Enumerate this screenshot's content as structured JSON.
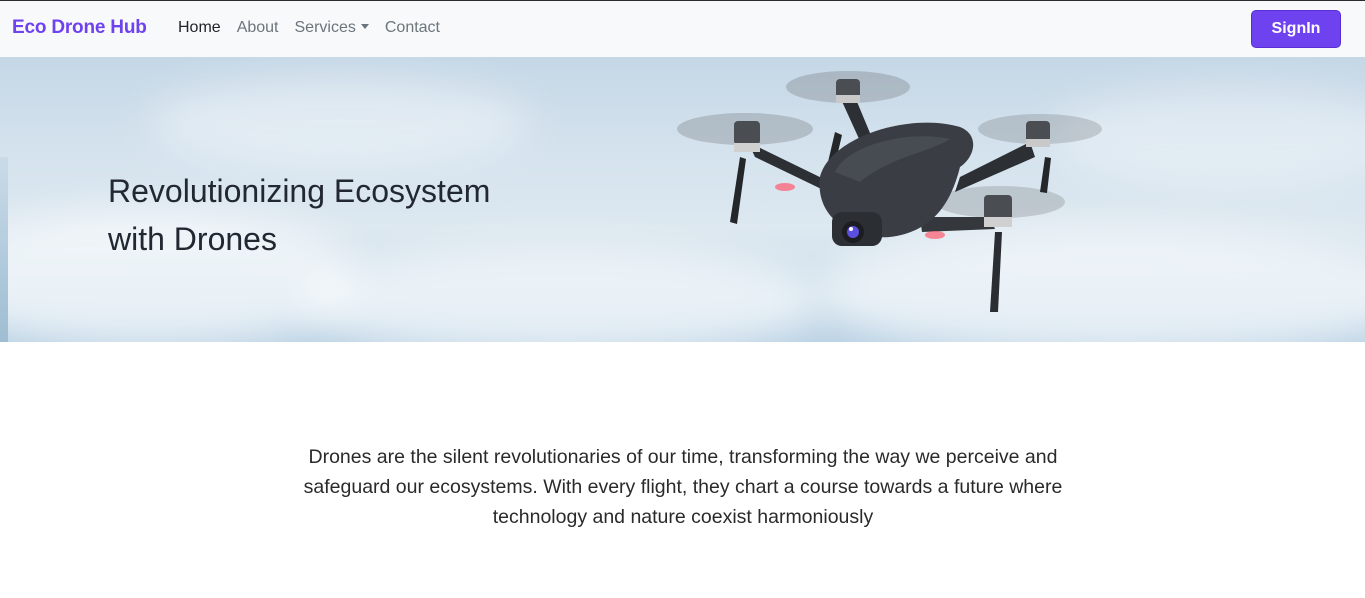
{
  "navbar": {
    "brand": "Eco Drone Hub",
    "links": [
      {
        "label": "Home",
        "active": true
      },
      {
        "label": "About",
        "active": false
      },
      {
        "label": "Services",
        "active": false,
        "dropdown": true
      },
      {
        "label": "Contact",
        "active": false
      }
    ],
    "signin_label": "SignIn"
  },
  "hero": {
    "title_line1": "Revolutionizing Ecosystem",
    "title_line2": "with Drones",
    "image": "drone-image"
  },
  "content": {
    "description": "Drones are the silent revolutionaries of our time, transforming the way we perceive and safeguard our ecosystems. With every flight, they chart a course towards a future where technology and nature coexist harmoniously"
  },
  "colors": {
    "accent": "#6f42f0",
    "navbar_bg": "#f8f9fa",
    "text_dark": "#212529",
    "text_muted": "#6c757d"
  }
}
